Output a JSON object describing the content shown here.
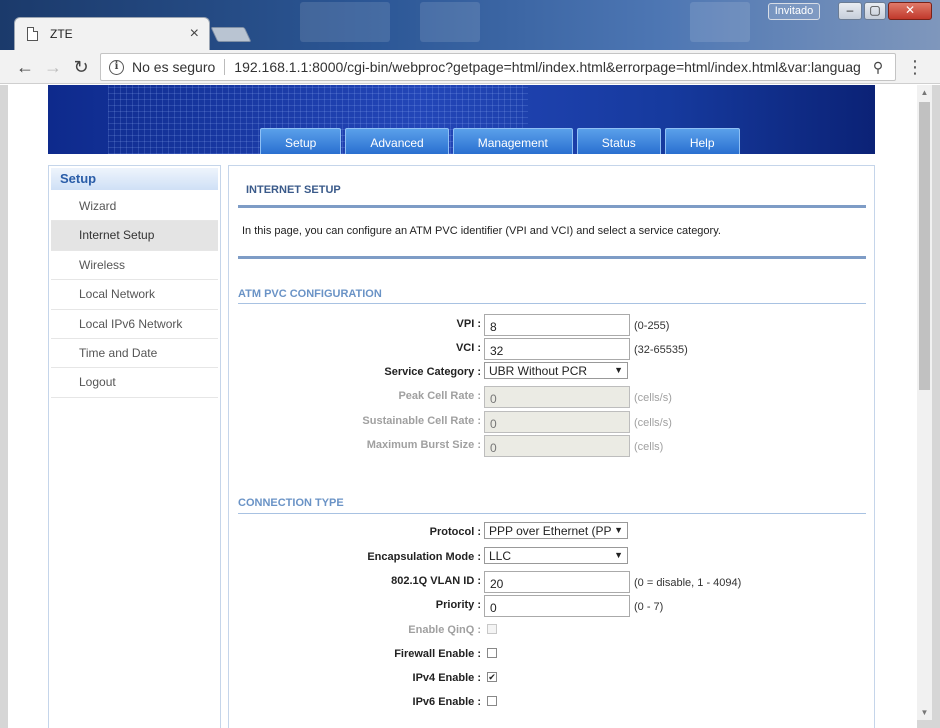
{
  "browser": {
    "tab_title": "ZTE",
    "guest_label": "Invitado",
    "security_label": "No es seguro",
    "url": "192.168.1.1:8000/cgi-bin/webproc?getpage=html/index.html&errorpage=html/index.html&var:languag",
    "window_controls": [
      "minimize-icon",
      "maximize-icon",
      "close-icon"
    ]
  },
  "nav": {
    "tabs": [
      "Setup",
      "Advanced",
      "Management",
      "Status",
      "Help"
    ],
    "active": "Setup"
  },
  "sidebar": {
    "heading": "Setup",
    "items": [
      "Wizard",
      "Internet Setup",
      "Wireless",
      "Local Network",
      "Local IPv6 Network",
      "Time and Date",
      "Logout"
    ],
    "active": "Internet Setup"
  },
  "page": {
    "title": "INTERNET SETUP",
    "intro": "In this page, you can configure an ATM PVC identifier (VPI and VCI) and select a service category."
  },
  "atm": {
    "section_title": "ATM PVC CONFIGURATION",
    "vpi": {
      "label": "VPI :",
      "value": "8",
      "hint": "(0-255)"
    },
    "vci": {
      "label": "VCI :",
      "value": "32",
      "hint": "(32-65535)"
    },
    "service_category": {
      "label": "Service Category :",
      "value": "UBR Without PCR"
    },
    "peak_cell_rate": {
      "label": "Peak Cell Rate :",
      "value": "0",
      "hint": "(cells/s)"
    },
    "sustainable_cell_rate": {
      "label": "Sustainable Cell Rate :",
      "value": "0",
      "hint": "(cells/s)"
    },
    "max_burst_size": {
      "label": "Maximum Burst Size :",
      "value": "0",
      "hint": "(cells)"
    }
  },
  "connection": {
    "section_title": "CONNECTION TYPE",
    "protocol": {
      "label": "Protocol :",
      "value": "PPP over Ethernet (PP"
    },
    "encapsulation": {
      "label": "Encapsulation Mode :",
      "value": "LLC"
    },
    "vlan_id": {
      "label": "802.1Q VLAN ID :",
      "value": "20",
      "hint": "(0 = disable, 1 - 4094)"
    },
    "priority": {
      "label": "Priority :",
      "value": "0",
      "hint": "(0 - 7)"
    },
    "enable_qinq": {
      "label": "Enable QinQ :",
      "checked": false
    },
    "firewall_enable": {
      "label": "Firewall Enable :",
      "checked": false
    },
    "ipv4_enable": {
      "label": "IPv4 Enable :",
      "checked": true
    },
    "ipv6_enable": {
      "label": "IPv6 Enable :",
      "checked": false
    }
  },
  "colors": {
    "nav_tab": "#2a6fd0",
    "section_title": "#6a93c6",
    "banner": "#1a3aa6"
  }
}
